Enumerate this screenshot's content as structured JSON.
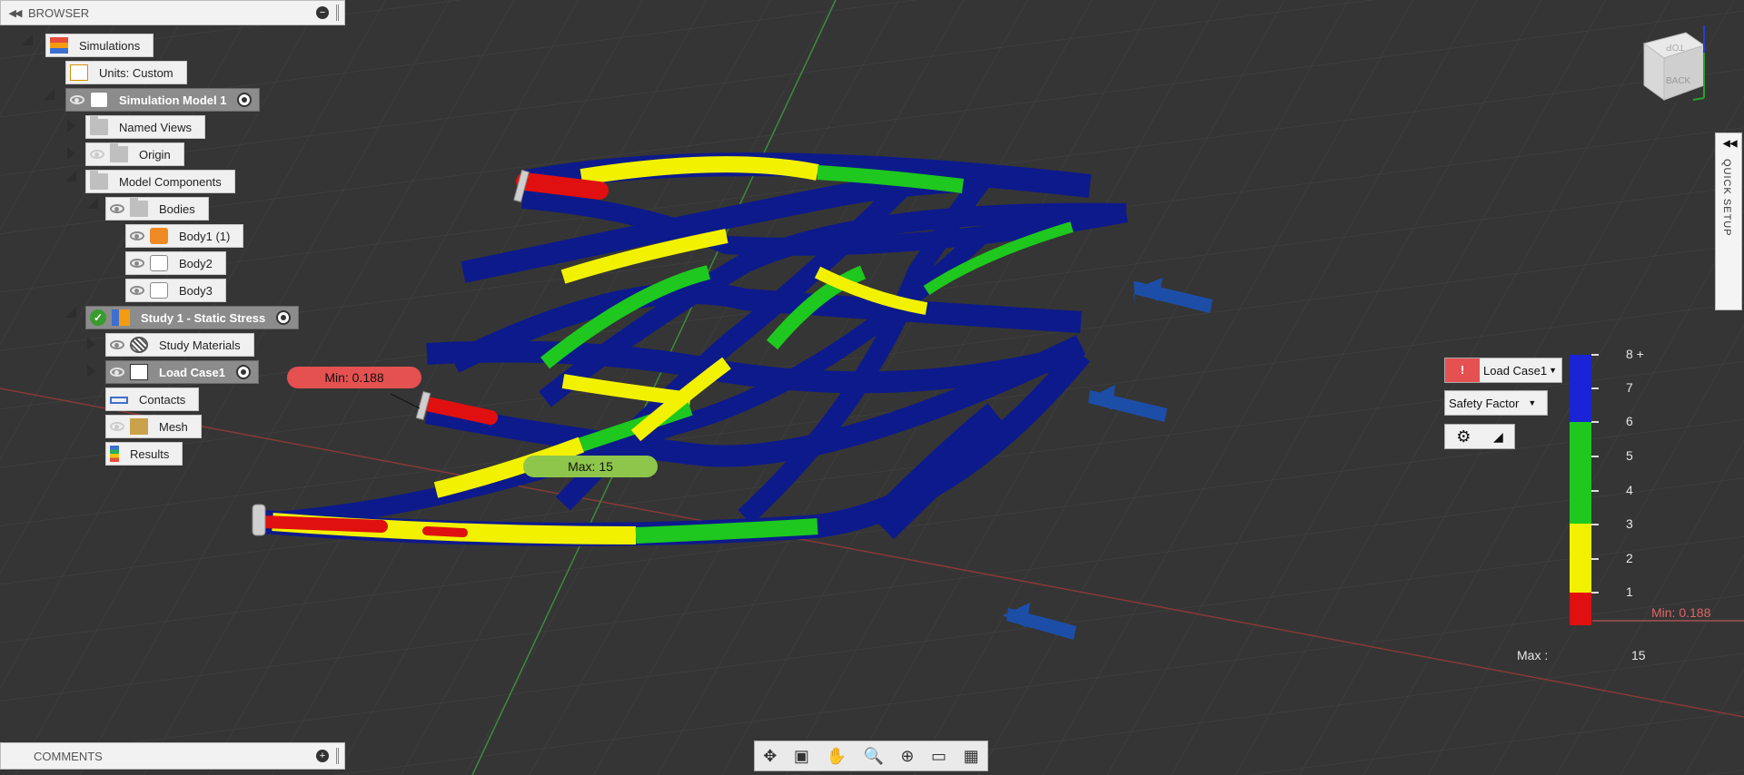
{
  "browser": {
    "title": "BROWSER"
  },
  "comments": {
    "title": "COMMENTS"
  },
  "tree": {
    "simulations": "Simulations",
    "units": "Units: Custom",
    "sim_model": "Simulation Model 1",
    "named_views": "Named Views",
    "origin": "Origin",
    "model_components": "Model Components",
    "bodies": "Bodies",
    "body1": "Body1 (1)",
    "body2": "Body2",
    "body3": "Body3",
    "study": "Study 1 - Static Stress",
    "study_materials": "Study Materials",
    "load_case": "Load Case1",
    "contacts": "Contacts",
    "mesh": "Mesh",
    "results": "Results"
  },
  "viewcube": {
    "top": "TOP",
    "back": "BACK"
  },
  "probes": {
    "min": "Min: 0.188",
    "max": "Max: 15"
  },
  "legend": {
    "load_case": "Load Case1",
    "result_type": "Safety Factor",
    "scale_labels": [
      "8 +",
      "7",
      "6",
      "5",
      "4",
      "3",
      "2",
      "1"
    ],
    "min_label": "Min: 0.188",
    "max_label": "Max :",
    "max_value": "15",
    "colors": {
      "blue": "#1a24d6",
      "green": "#1ec81e",
      "yellow": "#f2f200",
      "red": "#e01010"
    }
  },
  "quick_setup": "QUICK SETUP",
  "icons": [
    "orbit-icon",
    "look-at-icon",
    "pan-icon",
    "zoom-icon",
    "fit-icon",
    "display-settings-icon",
    "grid-icon"
  ]
}
